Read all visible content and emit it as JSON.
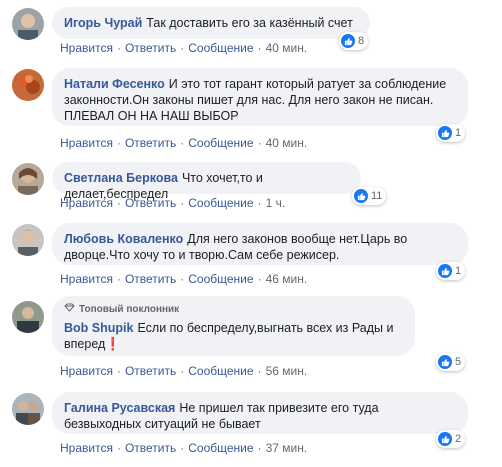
{
  "actions": {
    "like": "Нравится",
    "reply": "Ответить",
    "message": "Сообщение",
    "sep": "·"
  },
  "badge": {
    "top_fan": "Топовый поклонник"
  },
  "comments": [
    {
      "author": "Игорь Чурай",
      "text": "Так доставить его за казённый счет",
      "time": "40 мин.",
      "likes": "8"
    },
    {
      "author": "Натали Фесенко",
      "text": "И это тот гарант который ратует за соблюдение законности.Он законы пишет для нас. Для него закон не писан. ПЛЕВАЛ ОН НА НАШ ВЫБОР",
      "time": "40 мин.",
      "likes": "1"
    },
    {
      "author": "Светлана Беркова",
      "text": "Что хочет,то и делает,беспредел",
      "time": "1 ч.",
      "likes": "11"
    },
    {
      "author": "Любовь Коваленко",
      "text": "Для него законов вообще нет.Царь во дворце.Что хочу то и творю.Сам себе режисер.",
      "time": "46 мин.",
      "likes": "1"
    },
    {
      "author": "Bob Shupik",
      "text": "Если по беспределу,выгнать всех из Рады и вперед❗",
      "time": "56 мин.",
      "likes": "5"
    },
    {
      "author": "Галина Русавская",
      "text": "Не пришел так привезите его туда безвыходных ситуаций не бывает",
      "time": "37 мин.",
      "likes": "2"
    }
  ],
  "colors": {
    "link": "#385898",
    "bubble": "#f0f2f5",
    "like_blue": "#1877f2",
    "meta": "#65676b"
  }
}
